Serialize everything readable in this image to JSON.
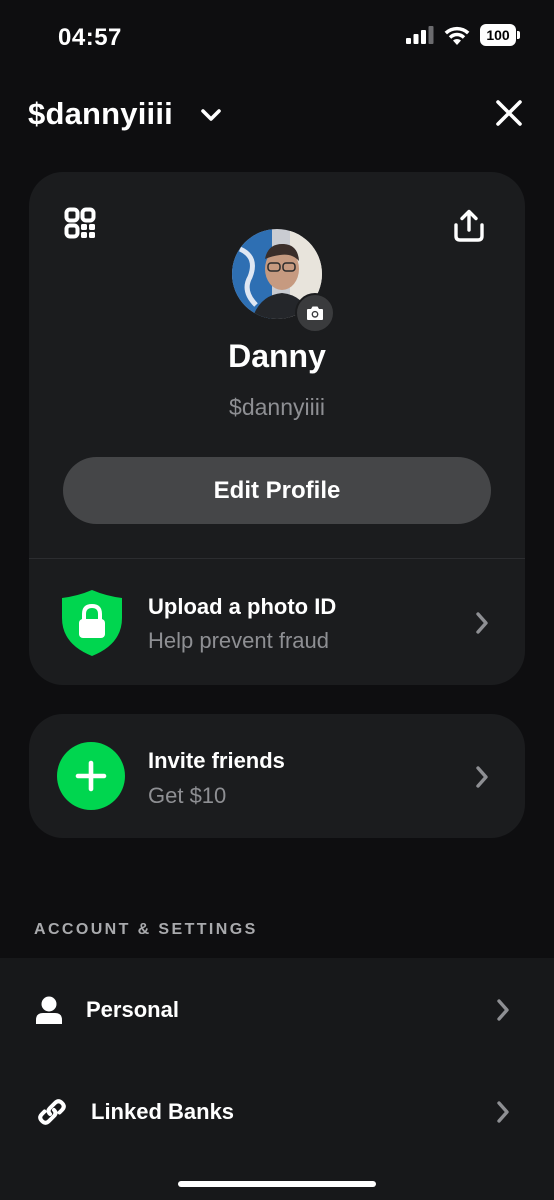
{
  "status_bar": {
    "time": "04:57",
    "battery": "100"
  },
  "header": {
    "handle": "$dannyiiii"
  },
  "profile": {
    "name": "Danny",
    "cashtag": "$dannyiiii",
    "edit_label": "Edit Profile",
    "id_title": "Upload a photo ID",
    "id_subtitle": "Help prevent fraud"
  },
  "invite": {
    "title": "Invite friends",
    "subtitle": "Get $10"
  },
  "settings": {
    "section_label": "ACCOUNT & SETTINGS",
    "items": [
      {
        "label": "Personal",
        "icon": "person-icon"
      },
      {
        "label": "Linked Banks",
        "icon": "link-icon"
      }
    ]
  },
  "colors": {
    "accent": "#00d64f",
    "card": "#1b1c1e",
    "background": "#0e0e10",
    "muted_text": "#8e8f93"
  }
}
